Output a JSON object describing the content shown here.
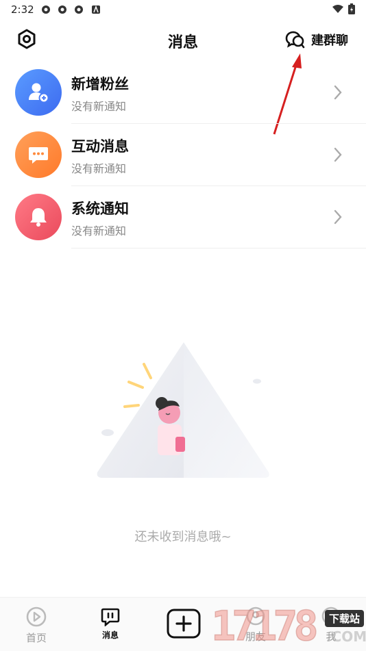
{
  "status_bar": {
    "time": "2:32"
  },
  "header": {
    "title": "消息",
    "group_chat_label": "建群聊"
  },
  "items": [
    {
      "title": "新增粉丝",
      "subtitle": "没有新通知",
      "color": "#4a7cf7"
    },
    {
      "title": "互动消息",
      "subtitle": "没有新通知",
      "color": "#ff8a3c"
    },
    {
      "title": "系统通知",
      "subtitle": "没有新通知",
      "color": "#f05a6a"
    }
  ],
  "empty_state": {
    "text": "还未收到消息哦~"
  },
  "bottom_nav": {
    "home_label": "首页",
    "messages_label": "消息",
    "friends_label": "朋友",
    "me_label": "我"
  },
  "watermark": {
    "text": "17178",
    "badge": "下载站",
    "sub": ".COM"
  }
}
